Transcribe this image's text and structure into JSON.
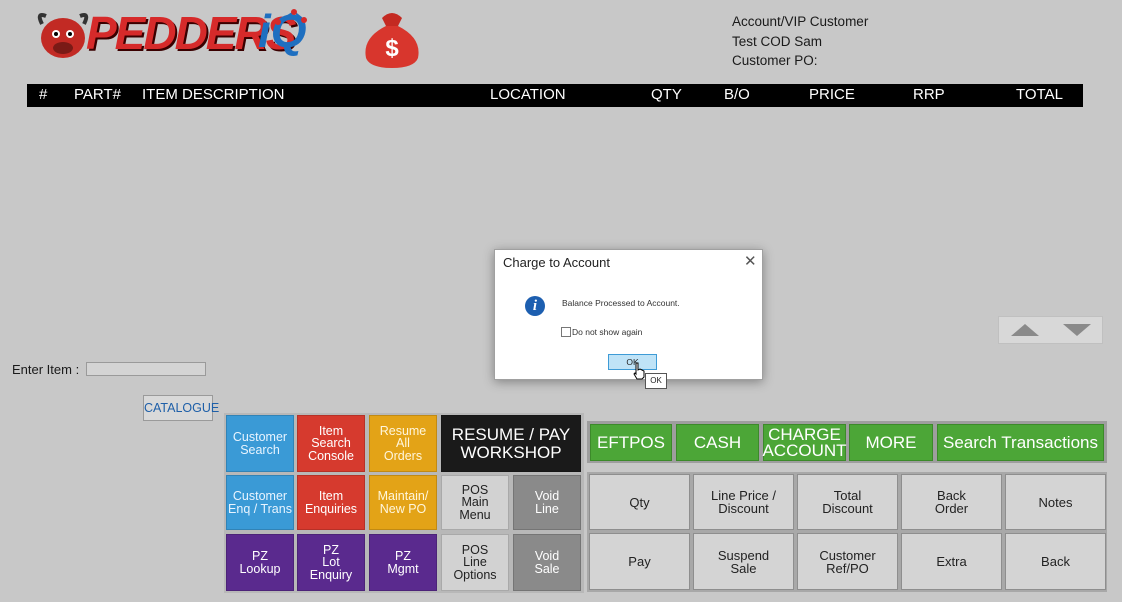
{
  "brand": {
    "logo_text": "PEDDERS",
    "logo_suffix": "iQ"
  },
  "customer": {
    "line1": "Account/VIP Customer",
    "line2": "Test COD Sam",
    "line3": "Customer PO:"
  },
  "table_header": {
    "num": "#",
    "part": "PART#",
    "desc": "ITEM DESCRIPTION",
    "location": "LOCATION",
    "qty": "QTY",
    "bo": "B/O",
    "price": "PRICE",
    "rrp": "RRP",
    "total": "TOTAL"
  },
  "entry": {
    "label": "Enter Item :",
    "catalogue": "CATALOGUE"
  },
  "tiles": {
    "customer_search": "Customer\nSearch",
    "item_search_console": "Item\nSearch\nConsole",
    "resume_all_orders": "Resume\nAll\nOrders",
    "resume_pay_workshop": "RESUME / PAY\nWORKSHOP",
    "customer_enq": "Customer\nEnq / Trans",
    "item_enquiries": "Item\nEnquiries",
    "maintain_new_po": "Maintain/\nNew PO",
    "pos_main_menu": "POS\nMain\nMenu",
    "void_line": "Void\nLine",
    "pz_lookup": "PZ\nLookup",
    "pz_lot_enquiry": "PZ\nLot\nEnquiry",
    "pz_mgmt": "PZ\nMgmt",
    "pos_line_options": "POS\nLine\nOptions",
    "void_sale": "Void\nSale"
  },
  "payment": {
    "eftpos": "EFTPOS",
    "cash": "CASH",
    "charge_account": "CHARGE\nACCOUNT",
    "more": "MORE",
    "search_transactions": "Search Transactions"
  },
  "actions": {
    "qty": "Qty",
    "line_price": "Line Price /\nDiscount",
    "total_discount": "Total\nDiscount",
    "back_order": "Back\nOrder",
    "notes": "Notes",
    "pay": "Pay",
    "suspend_sale": "Suspend\nSale",
    "customer_ref": "Customer\nRef/PO",
    "extra": "Extra",
    "back": "Back"
  },
  "dialog": {
    "title": "Charge to Account",
    "close_glyph": "✕",
    "message": "Balance Processed to Account.",
    "checkbox_label": "Do not show again",
    "ok": "OK",
    "tooltip": "OK"
  },
  "icons": {
    "info": "info-icon",
    "money_bag": "money-bag-icon",
    "up": "arrow-up-icon",
    "down": "arrow-down-icon"
  },
  "colors": {
    "background": "#c8c8c8",
    "blue_tile": "#3a9ad6",
    "red_tile": "#d63a2e",
    "orange_tile": "#e3a317",
    "purple_tile": "#5a2a8e",
    "green_tile": "#4ca637",
    "header_bar": "#000000"
  }
}
